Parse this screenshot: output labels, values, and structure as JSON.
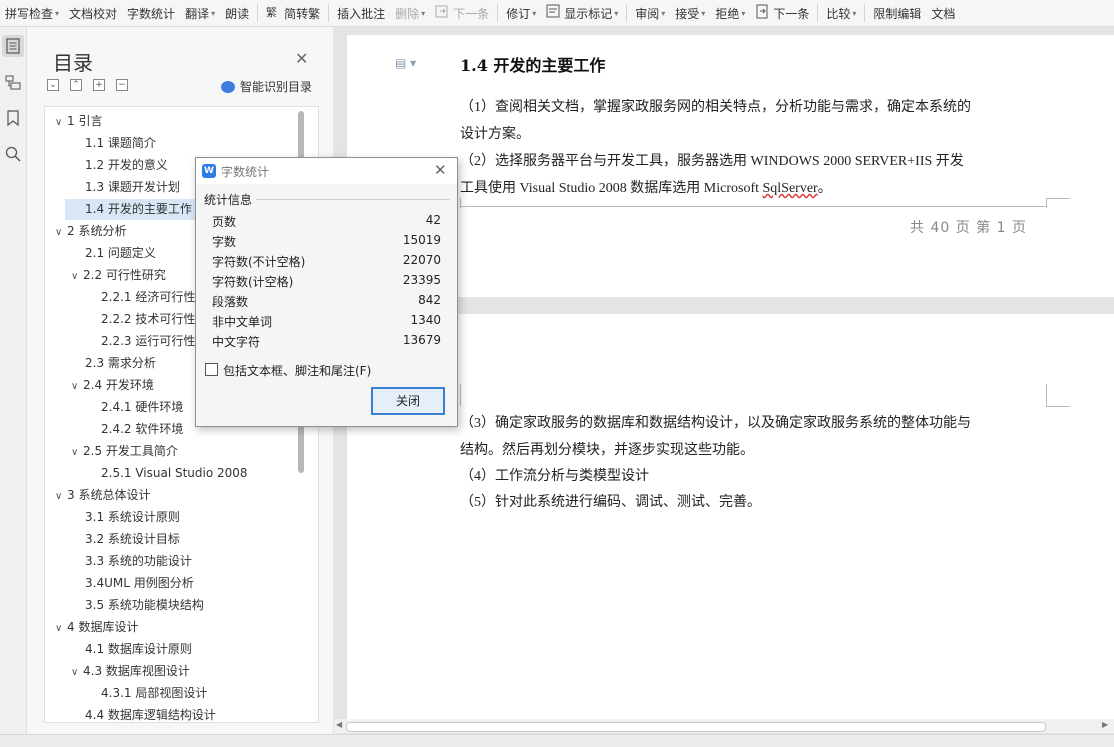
{
  "ribbon": {
    "items": [
      {
        "label": "拼写检查",
        "dropdown": true,
        "disabled": false
      },
      {
        "label": "文档校对",
        "dropdown": false,
        "disabled": false
      },
      {
        "label": "字数统计",
        "dropdown": false,
        "disabled": false
      },
      {
        "label": "翻译",
        "dropdown": true,
        "disabled": false
      },
      {
        "label": "朗读",
        "dropdown": false,
        "disabled": false
      },
      {
        "label": "简转繁",
        "dropdown": false,
        "disabled": false,
        "icon": "traditional-chinese-icon"
      },
      {
        "label": "插入批注",
        "dropdown": false,
        "disabled": false
      },
      {
        "label": "删除",
        "dropdown": true,
        "disabled": true
      },
      {
        "label": "下一条",
        "dropdown": false,
        "disabled": true,
        "icon": "next-comment-icon"
      },
      {
        "label": "修订",
        "dropdown": true,
        "disabled": false
      },
      {
        "label": "显示标记",
        "dropdown": true,
        "disabled": false,
        "icon": "show-markup-icon"
      },
      {
        "label": "审阅",
        "dropdown": true,
        "disabled": false
      },
      {
        "label": "接受",
        "dropdown": true,
        "disabled": false
      },
      {
        "label": "拒绝",
        "dropdown": true,
        "disabled": false
      },
      {
        "label": "下一条",
        "dropdown": false,
        "disabled": false,
        "icon": "next-change-icon"
      },
      {
        "label": "比较",
        "dropdown": true,
        "disabled": false
      },
      {
        "label": "限制编辑",
        "dropdown": false,
        "disabled": false
      },
      {
        "label": "文档",
        "dropdown": false,
        "disabled": false
      }
    ]
  },
  "rail": {
    "icons": [
      "toc-icon",
      "navigation-icon",
      "bookmark-icon",
      "search-icon"
    ]
  },
  "toc": {
    "title": "目录",
    "smart_label": "智能识别目录",
    "items": [
      {
        "label": "1 引言",
        "level": 1,
        "caret": "∨",
        "selected": false
      },
      {
        "label": "1.1 课题简介",
        "level": 2,
        "caret": "",
        "selected": false
      },
      {
        "label": "1.2 开发的意义",
        "level": 2,
        "caret": "",
        "selected": false
      },
      {
        "label": "1.3 课题开发计划",
        "level": 2,
        "caret": "",
        "selected": false
      },
      {
        "label": "1.4 开发的主要工作",
        "level": 2,
        "caret": "",
        "selected": true
      },
      {
        "label": "2 系统分析",
        "level": 1,
        "caret": "∨",
        "selected": false
      },
      {
        "label": "2.1 问题定义",
        "level": 2,
        "caret": "",
        "selected": false
      },
      {
        "label": "2.2 可行性研究",
        "level": 2,
        "caret": "∨",
        "selected": false
      },
      {
        "label": "2.2.1 经济可行性",
        "level": 3,
        "caret": "",
        "selected": false
      },
      {
        "label": "2.2.2 技术可行性",
        "level": 3,
        "caret": "",
        "selected": false
      },
      {
        "label": "2.2.3 运行可行性",
        "level": 3,
        "caret": "",
        "selected": false
      },
      {
        "label": "2.3 需求分析",
        "level": 2,
        "caret": "",
        "selected": false
      },
      {
        "label": "2.4 开发环境",
        "level": 2,
        "caret": "∨",
        "selected": false
      },
      {
        "label": "2.4.1 硬件环境",
        "level": 3,
        "caret": "",
        "selected": false
      },
      {
        "label": "2.4.2 软件环境",
        "level": 3,
        "caret": "",
        "selected": false
      },
      {
        "label": "2.5 开发工具简介",
        "level": 2,
        "caret": "∨",
        "selected": false
      },
      {
        "label": "2.5.1 Visual Studio 2008",
        "level": 3,
        "caret": "",
        "selected": false
      },
      {
        "label": "3 系统总体设计",
        "level": 1,
        "caret": "∨",
        "selected": false
      },
      {
        "label": "3.1 系统设计原则",
        "level": 2,
        "caret": "",
        "selected": false
      },
      {
        "label": "3.2 系统设计目标",
        "level": 2,
        "caret": "",
        "selected": false
      },
      {
        "label": "3.3 系统的功能设计",
        "level": 2,
        "caret": "",
        "selected": false
      },
      {
        "label": "3.4UML 用例图分析",
        "level": 2,
        "caret": "",
        "selected": false
      },
      {
        "label": "3.5 系统功能模块结构",
        "level": 2,
        "caret": "",
        "selected": false
      },
      {
        "label": "4 数据库设计",
        "level": 1,
        "caret": "∨",
        "selected": false
      },
      {
        "label": "4.1 数据库设计原则",
        "level": 2,
        "caret": "",
        "selected": false
      },
      {
        "label": "4.3 数据库视图设计",
        "level": 2,
        "caret": "∨",
        "selected": false
      },
      {
        "label": "4.3.1 局部视图设计",
        "level": 3,
        "caret": "",
        "selected": false
      },
      {
        "label": "4.4 数据库逻辑结构设计",
        "level": 2,
        "caret": "",
        "selected": false
      }
    ]
  },
  "document": {
    "heading": "1.4 开发的主要工作",
    "p1_lines": [
      "（1）查阅相关文档，掌握家政服务网的相关特点，分析功能与需求，确定本系统的",
      "设计方案。"
    ],
    "p2_line1": "（2）选择服务器平台与开发工具，服务器选用 WINDOWS 2000 SERVER+IIS  开发",
    "p2_line2_pre": "工具使用  Visual Studio 2008  数据库选用 Microsoft ",
    "p2_line2_wavy": "SqlServer",
    "p2_line2_post": "。",
    "footer": "共 40 页    第  1  页",
    "p3_lines": [
      "（3）确定家政服务的数据库和数据结构设计，以及确定家政服务系统的整体功能与",
      "结构。然后再划分模块，并逐步实现这些功能。"
    ],
    "p4": "（4）工作流分析与类模型设计",
    "p5": "（5）针对此系统进行编码、调试、测试、完善。"
  },
  "dialog": {
    "title": "字数统计",
    "group_label": "统计信息",
    "stats": [
      {
        "label": "页数",
        "value": "42"
      },
      {
        "label": "字数",
        "value": "15019"
      },
      {
        "label": "字符数(不计空格)",
        "value": "22070"
      },
      {
        "label": "字符数(计空格)",
        "value": "23395"
      },
      {
        "label": "段落数",
        "value": "842"
      },
      {
        "label": "非中文单词",
        "value": "1340"
      },
      {
        "label": "中文字符",
        "value": "13679"
      }
    ],
    "checkbox_label": "包括文本框、脚注和尾注(F)",
    "checkbox_checked": false,
    "close_button": "关闭"
  },
  "colors": {
    "accent": "#2f7ae5",
    "selected_row": "#d8e6f6",
    "wavy": "#d33333"
  }
}
